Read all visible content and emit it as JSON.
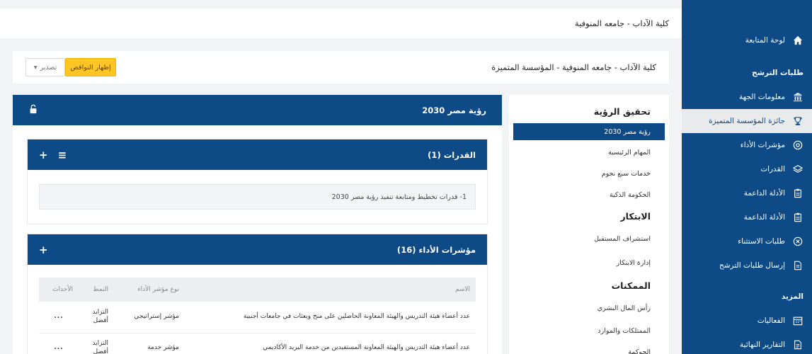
{
  "header": {
    "org_title": "كلية الآداب - جامعه المنوفية"
  },
  "page": {
    "title": "كلية الآداب - جامعه المنوفية - المؤسسة المتميزة",
    "show_missing_label": "إظهار النواقص",
    "export_label": "تصدير",
    "export_caret": "▾"
  },
  "sidebar": {
    "dashboard": "لوحة المتابعة",
    "section_requests": "طلبات الترشح",
    "items": [
      {
        "label": "معلومات الجهة",
        "icon": "institution-icon"
      },
      {
        "label": "جائزة المؤسسة المتميزة",
        "icon": "trophy-icon"
      },
      {
        "label": "مؤشرات الأداء",
        "icon": "dashboard-gauge-icon"
      },
      {
        "label": "القدرات",
        "icon": "layers-icon"
      },
      {
        "label": "الأدلة الداعمة",
        "icon": "clipboard-icon"
      },
      {
        "label": "الأدلة الداعمة",
        "icon": "clipboard-icon"
      },
      {
        "label": "طلبات الاستثناء",
        "icon": "circle-x-icon"
      },
      {
        "label": "إرسال طلبات الترشح",
        "icon": "document-send-icon"
      }
    ],
    "section_more": "المزيد",
    "more_items": [
      {
        "label": "الفعاليات",
        "icon": "calendar-icon"
      },
      {
        "label": "التقارير النهائية",
        "icon": "report-icon"
      }
    ]
  },
  "nav": {
    "groups": [
      {
        "heading": "تحقيق الرؤية",
        "items": [
          "رؤية مصر 2030",
          "المهام الرئيسية",
          "خدمات سبع نجوم",
          "الحكومة الذكية"
        ]
      },
      {
        "heading": "الابتكار",
        "items": [
          "استشراف المستقبل",
          "إدارة الابتكار"
        ]
      },
      {
        "heading": "الممكنات",
        "items": [
          "رأس المال البشري",
          "الممتلكات والموارد",
          "الحوكمة"
        ]
      }
    ],
    "active_item": "رؤية مصر 2030"
  },
  "vision": {
    "title": "رؤية مصر 2030"
  },
  "capabilities": {
    "title": "القدرات (1)",
    "row": "1- قدرات تخطيط ومتابعة تنفيذ رؤية مصر 2030"
  },
  "kpis": {
    "title": "مؤشرات الأداء (16)",
    "columns": [
      "الاسم",
      "نوع مؤشر الأداء",
      "النمط",
      "الأحداث"
    ],
    "rows": [
      {
        "name": "عدد أعضاء هيئة التدريس والهيئة المعاونة الحاصلين على منح وبعثات في جامعات أجنبية",
        "type": "مؤشر إستراتيجي",
        "pattern": "التزايد أفضل",
        "actions": "..."
      },
      {
        "name": "عدد أعضاء هيئة التدريس والهيئة المعاونة المستفيدين من خدمة البريد الأكاديمي",
        "type": "مؤشر خدمة",
        "pattern": "التزايد أفضل",
        "actions": "..."
      }
    ]
  },
  "colors": {
    "primary": "#0d4a86",
    "accent": "#ffc524",
    "background": "#f2f3f5"
  }
}
